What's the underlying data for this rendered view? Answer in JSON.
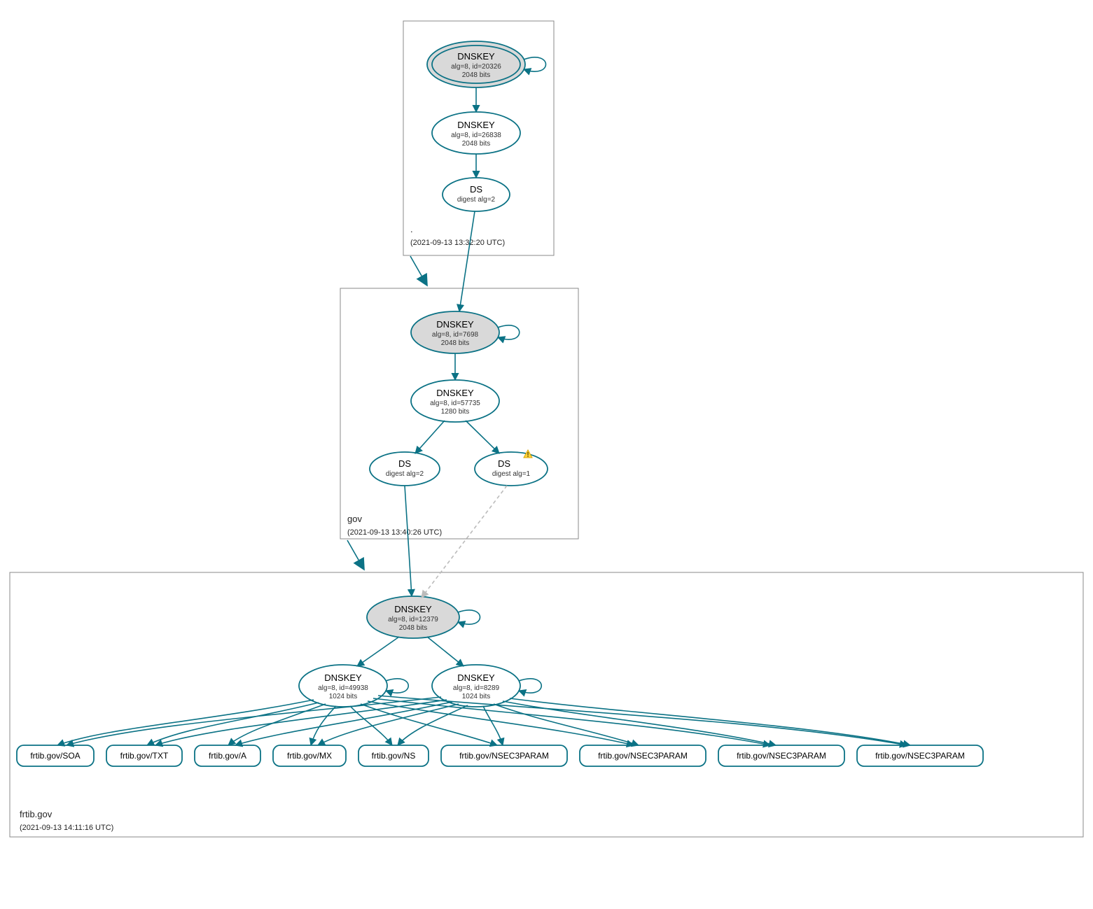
{
  "color": "#0b7285",
  "zones": {
    "root": {
      "name": ".",
      "ts": "(2021-09-13 13:32:20 UTC)"
    },
    "gov": {
      "name": "gov",
      "ts": "(2021-09-13 13:40:26 UTC)"
    },
    "frtib": {
      "name": "frtib.gov",
      "ts": "(2021-09-13 14:11:16 UTC)"
    }
  },
  "nodes": {
    "rootKSK": {
      "title": "DNSKEY",
      "l1": "alg=8, id=20326",
      "l2": "2048 bits"
    },
    "rootZSK": {
      "title": "DNSKEY",
      "l1": "alg=8, id=26838",
      "l2": "2048 bits"
    },
    "rootDS": {
      "title": "DS",
      "l1": "digest alg=2",
      "l2": ""
    },
    "govKSK": {
      "title": "DNSKEY",
      "l1": "alg=8, id=7698",
      "l2": "2048 bits"
    },
    "govZSK": {
      "title": "DNSKEY",
      "l1": "alg=8, id=57735",
      "l2": "1280 bits"
    },
    "govDS2": {
      "title": "DS",
      "l1": "digest alg=2",
      "l2": ""
    },
    "govDS1": {
      "title": "DS",
      "l1": "digest alg=1",
      "l2": ""
    },
    "frtibKSK": {
      "title": "DNSKEY",
      "l1": "alg=8, id=12379",
      "l2": "2048 bits"
    },
    "frtibZ1": {
      "title": "DNSKEY",
      "l1": "alg=8, id=49938",
      "l2": "1024 bits"
    },
    "frtibZ2": {
      "title": "DNSKEY",
      "l1": "alg=8, id=8289",
      "l2": "1024 bits"
    }
  },
  "rr": {
    "soa": "frtib.gov/SOA",
    "txt": "frtib.gov/TXT",
    "a": "frtib.gov/A",
    "mx": "frtib.gov/MX",
    "ns": "frtib.gov/NS",
    "n1": "frtib.gov/NSEC3PARAM",
    "n2": "frtib.gov/NSEC3PARAM",
    "n3": "frtib.gov/NSEC3PARAM",
    "n4": "frtib.gov/NSEC3PARAM"
  }
}
